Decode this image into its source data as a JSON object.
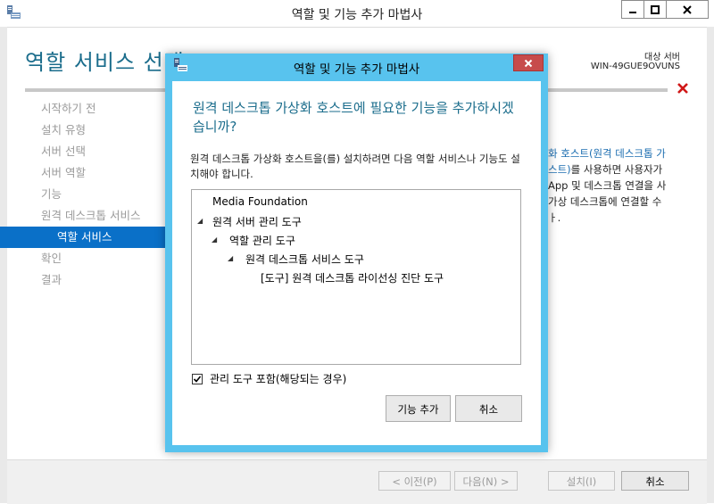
{
  "window": {
    "title": "역할 및 기능 추가 마법사"
  },
  "page": {
    "title": "역할 서비스 선택",
    "target_label": "대상 서버",
    "target_server": "WIN-49GUE9OVUNS"
  },
  "nav": {
    "items": [
      {
        "label": "시작하기 전"
      },
      {
        "label": "설치 유형"
      },
      {
        "label": "서버 선택"
      },
      {
        "label": "서버 역할"
      },
      {
        "label": "기능"
      },
      {
        "label": "원격 데스크톱 서비스"
      },
      {
        "label": "역할 서비스"
      },
      {
        "label": "확인"
      },
      {
        "label": "결과"
      }
    ]
  },
  "description": {
    "line1_link": "화 호스트(원격 데스크톱 가",
    "line2_link": "스트)",
    "line2_rest": "를 사용하면 사용자가",
    "line3": "App 및 데스크톱 연결을 사",
    "line4": "가상 데스크톱에 연결할 수",
    "line5": "ㅏ."
  },
  "bottom": {
    "prev": "< 이전(P)",
    "next": "다음(N) >",
    "install": "설치(I)",
    "cancel": "취소"
  },
  "dialog": {
    "title": "역할 및 기능 추가 마법사",
    "heading": "원격 데스크톱 가상화 호스트에 필요한 기능을 추가하시겠습니까?",
    "message": "원격 데스크톱 가상화 호스트을(를) 설치하려면 다음 역할 서비스나 기능도 설치해야 합니다.",
    "tree": {
      "media_foundation": "Media Foundation",
      "remote_admin_tools": "원격 서버 관리 도구",
      "role_admin_tools": "역할 관리 도구",
      "rds_tools": "원격 데스크톱 서비스 도구",
      "licensing_tool": "[도구] 원격 데스크톱 라이선싱 진단 도구"
    },
    "include_tools_label": "관리 도구 포함(해당되는 경우)",
    "include_tools_checked": true,
    "add_button": "기능 추가",
    "cancel_button": "취소"
  }
}
